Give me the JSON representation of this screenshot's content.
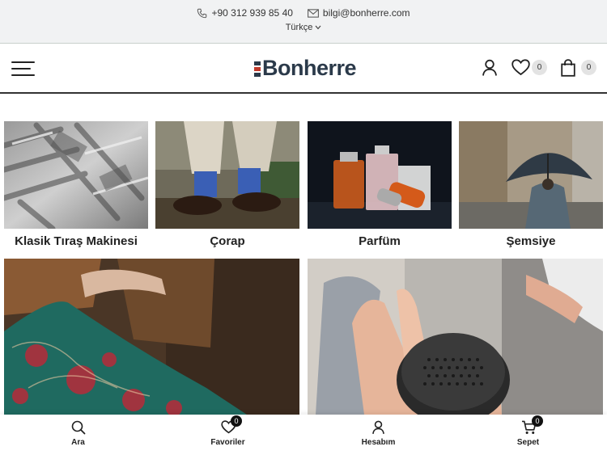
{
  "topbar": {
    "phone": "+90 312 939 85 40",
    "email": "bilgi@bonherre.com",
    "language": "Türkçe"
  },
  "header": {
    "logo_text": "Bonherre",
    "wishlist_count": "0",
    "cart_count": "0"
  },
  "categories": [
    {
      "label": "Klasik Tıraş Makinesi"
    },
    {
      "label": "Çorap"
    },
    {
      "label": "Parfüm"
    },
    {
      "label": "Şemsiye"
    },
    {
      "label": ""
    },
    {
      "label": ""
    }
  ],
  "bottom_nav": {
    "search_label": "Ara",
    "favorites_label": "Favoriler",
    "favorites_count": "0",
    "account_label": "Hesabım",
    "cart_label": "Sepet",
    "cart_count": "0"
  },
  "colors": {
    "brand_navy": "#2b3a4a",
    "brand_red": "#c0392b",
    "topbar_bg": "#f1f2f3",
    "badge_bg": "#e3e3e3",
    "nav_badge_bg": "#111111"
  }
}
